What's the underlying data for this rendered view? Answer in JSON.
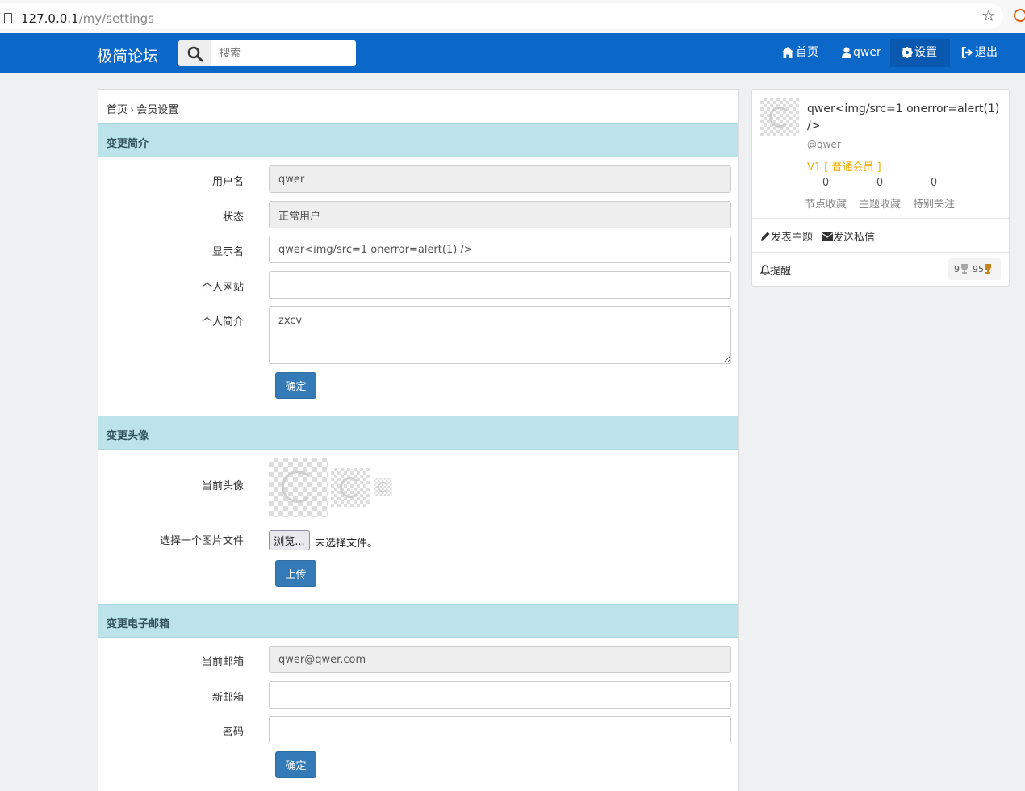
{
  "browser": {
    "url_host": "127.0.0.1",
    "url_path": "/my/settings"
  },
  "navbar": {
    "brand": "极简论坛",
    "search_placeholder": "搜索",
    "items": [
      {
        "label": "首页",
        "icon": "home-icon"
      },
      {
        "label": "qwer",
        "icon": "user-icon"
      },
      {
        "label": "设置",
        "icon": "gear-icon",
        "active": true
      },
      {
        "label": "退出",
        "icon": "sign-out-icon"
      }
    ],
    "color": "#0b68c8"
  },
  "breadcrumb": {
    "home": "首页",
    "separator": "›",
    "current": "会员设置"
  },
  "profile_section": {
    "title": "变更简介",
    "username_label": "用户名",
    "username_value": "qwer",
    "status_label": "状态",
    "status_value": "正常用户",
    "display_name_label": "显示名",
    "display_name_value": "qwer<img/src=1 onerror=alert(1) />",
    "website_label": "个人网站",
    "website_value": "",
    "bio_label": "个人简介",
    "bio_value": "zxcv",
    "submit_label": "确定"
  },
  "avatar_section": {
    "title": "变更头像",
    "current_label": "当前头像",
    "file_label": "选择一个图片文件",
    "browse_label": "浏览...",
    "no_file_text": "未选择文件。",
    "upload_label": "上传"
  },
  "email_section": {
    "title": "变更电子邮箱",
    "current_label": "当前邮箱",
    "current_value": "qwer@qwer.com",
    "new_label": "新邮箱",
    "new_value": "",
    "password_label": "密码",
    "password_value": "",
    "submit_label": "确定"
  },
  "sidebar": {
    "display_name": "qwer<img/src=1 onerror=alert(1) />",
    "handle": "@qwer",
    "level": "V1 [ 普通会员 ]",
    "stats": [
      {
        "value": "0",
        "label": "节点收藏"
      },
      {
        "value": "0",
        "label": "主题收藏"
      },
      {
        "value": "0",
        "label": "特别关注"
      }
    ],
    "post_topic_label": "发表主题",
    "send_message_label": "发送私信",
    "notify_label": "提醒",
    "silver_count": "9",
    "gold_count": "95"
  }
}
